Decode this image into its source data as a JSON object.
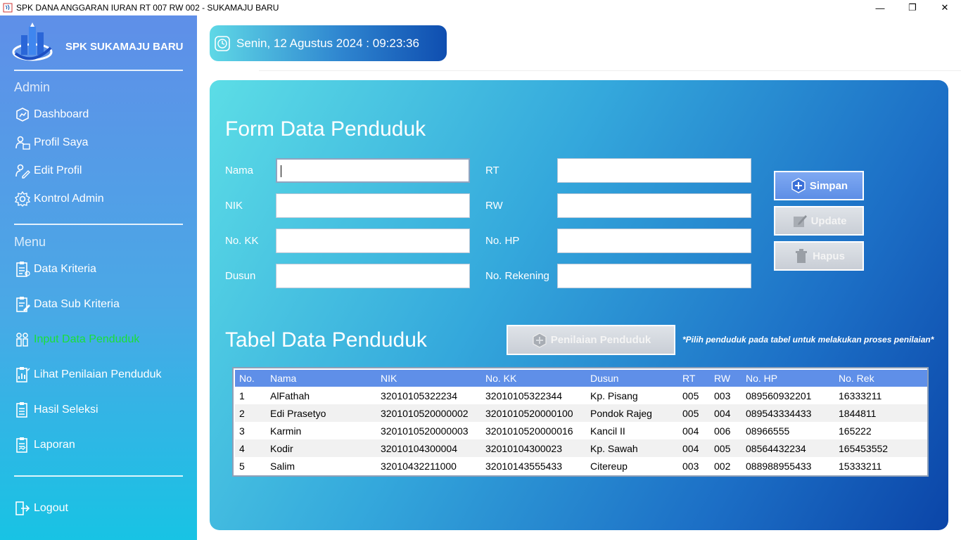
{
  "window": {
    "title": "SPK DANA ANGGARAN IURAN RT 007 RW 002 - SUKAMAJU BARU",
    "minimize": "—",
    "restore": "❐",
    "close": "✕"
  },
  "sidebar": {
    "brand": "SPK SUKAMAJU BARU",
    "admin_label": "Admin",
    "menu_label": "Menu",
    "admin_items": [
      {
        "label": "Dashboard",
        "icon": "dashboard-icon"
      },
      {
        "label": "Profil Saya",
        "icon": "user-card-icon"
      },
      {
        "label": "Edit Profil",
        "icon": "user-edit-icon"
      },
      {
        "label": "Kontrol Admin",
        "icon": "gear-icon"
      }
    ],
    "menu_items": [
      {
        "label": "Data Kriteria",
        "icon": "clipboard-icon"
      },
      {
        "label": "Data Sub Kriteria",
        "icon": "clipboard-edit-icon"
      },
      {
        "label": "Input Data Penduduk",
        "icon": "people-icon",
        "active": true
      },
      {
        "label": "Lihat Penilaian Penduduk",
        "icon": "clipboard-chart-icon"
      },
      {
        "label": "Hasil Seleksi",
        "icon": "clipboard-list-icon"
      },
      {
        "label": "Laporan",
        "icon": "report-icon"
      }
    ],
    "logout": "Logout"
  },
  "datetime": "Senin, 12 Agustus 2024 : 09:23:36",
  "form": {
    "title": "Form Data Penduduk",
    "fields": {
      "nama": {
        "label": "Nama",
        "value": ""
      },
      "nik": {
        "label": "NIK",
        "value": ""
      },
      "no_kk": {
        "label": "No. KK",
        "value": ""
      },
      "dusun": {
        "label": "Dusun",
        "value": ""
      },
      "rt": {
        "label": "RT",
        "value": ""
      },
      "rw": {
        "label": "RW",
        "value": ""
      },
      "no_hp": {
        "label": "No. HP",
        "value": ""
      },
      "no_rekening": {
        "label": "No. Rekening",
        "value": ""
      }
    },
    "buttons": {
      "simpan": "Simpan",
      "update": "Update",
      "hapus": "Hapus"
    }
  },
  "table": {
    "title": "Tabel Data Penduduk",
    "assess_button": "Penilaian Penduduk",
    "note": "*Pilih penduduk pada tabel untuk melakukan proses penilaian*",
    "headers": [
      "No.",
      "Nama",
      "NIK",
      "No. KK",
      "Dusun",
      "RT",
      "RW",
      "No. HP",
      "No. Rek"
    ],
    "rows": [
      [
        "1",
        "AlFathah",
        "32010105322234",
        "32010105322344",
        "Kp. Pisang",
        "005",
        "003",
        "089560932201",
        "16333211"
      ],
      [
        "2",
        "Edi Prasetyo",
        "3201010520000002",
        "3201010520000100",
        "Pondok Rajeg",
        "005",
        "004",
        "089543334433",
        "1844811"
      ],
      [
        "3",
        "Karmin",
        "3201010520000003",
        "3201010520000016",
        "Kancil II",
        "004",
        "006",
        "08966555",
        "165222"
      ],
      [
        "4",
        "Kodir",
        "32010104300004",
        "32010104300023",
        "Kp. Sawah",
        "004",
        "005",
        "08564432234",
        "165453552"
      ],
      [
        "5",
        "Salim",
        "32010432211000",
        "32010143555433",
        "Citereup",
        "003",
        "002",
        "088988955433",
        "15333211"
      ]
    ]
  },
  "colors": {
    "active_menu": "#19e038",
    "header_row": "#5f8fe8",
    "panel_dark": "#0b45a8",
    "panel_light": "#5cdde6"
  }
}
